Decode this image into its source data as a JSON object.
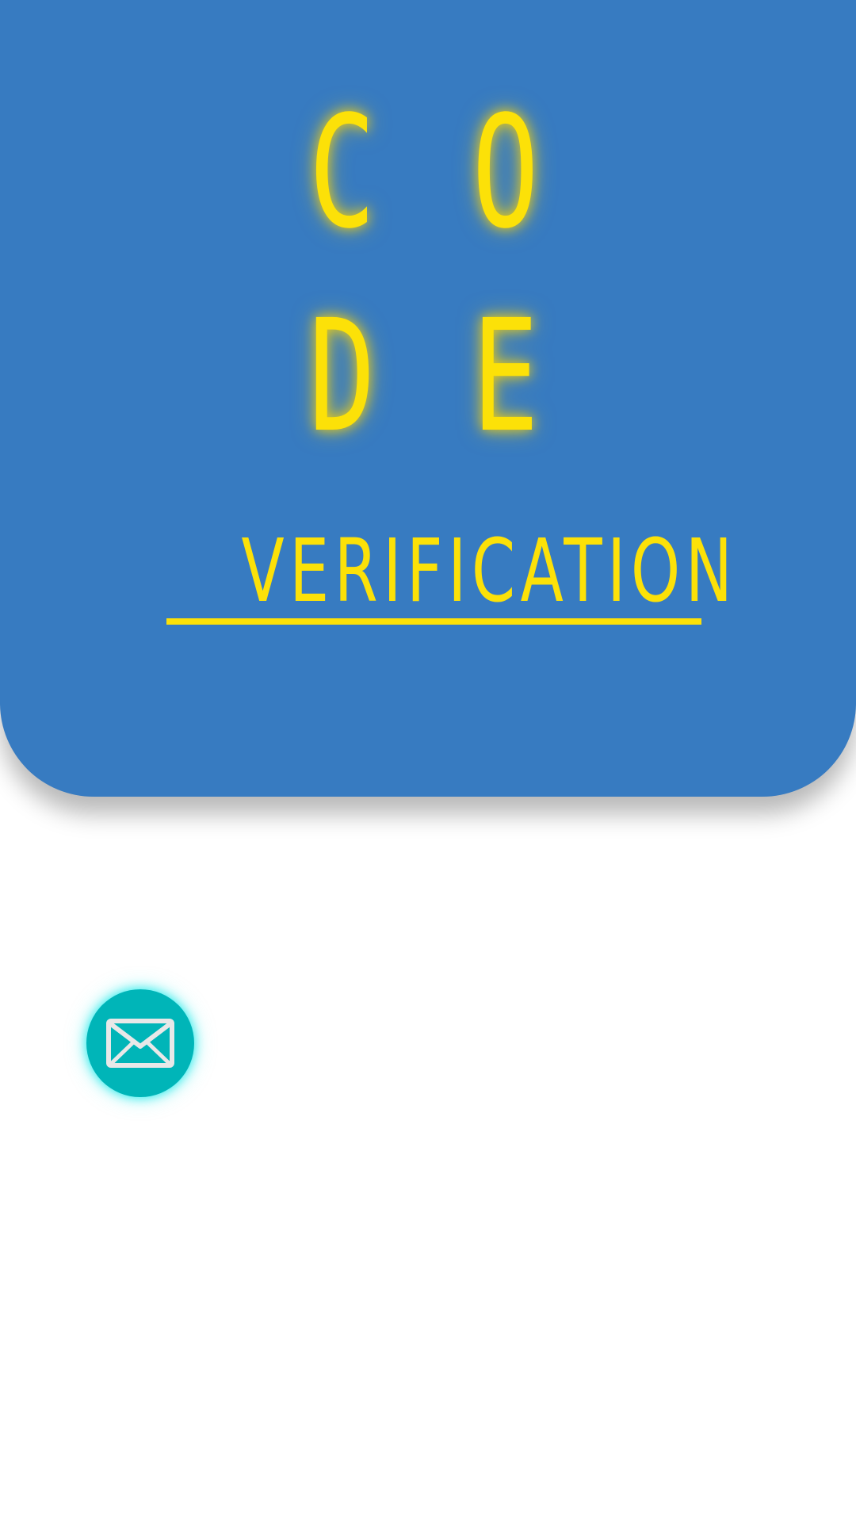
{
  "hero": {
    "code_letters": [
      "C",
      "O",
      "D",
      "E"
    ],
    "subtitle": "VERIFICATION",
    "background_color": "#377bc1",
    "accent_color": "#fce108"
  },
  "email_button": {
    "icon": "mail-icon",
    "background_color": "#00b5b8"
  }
}
